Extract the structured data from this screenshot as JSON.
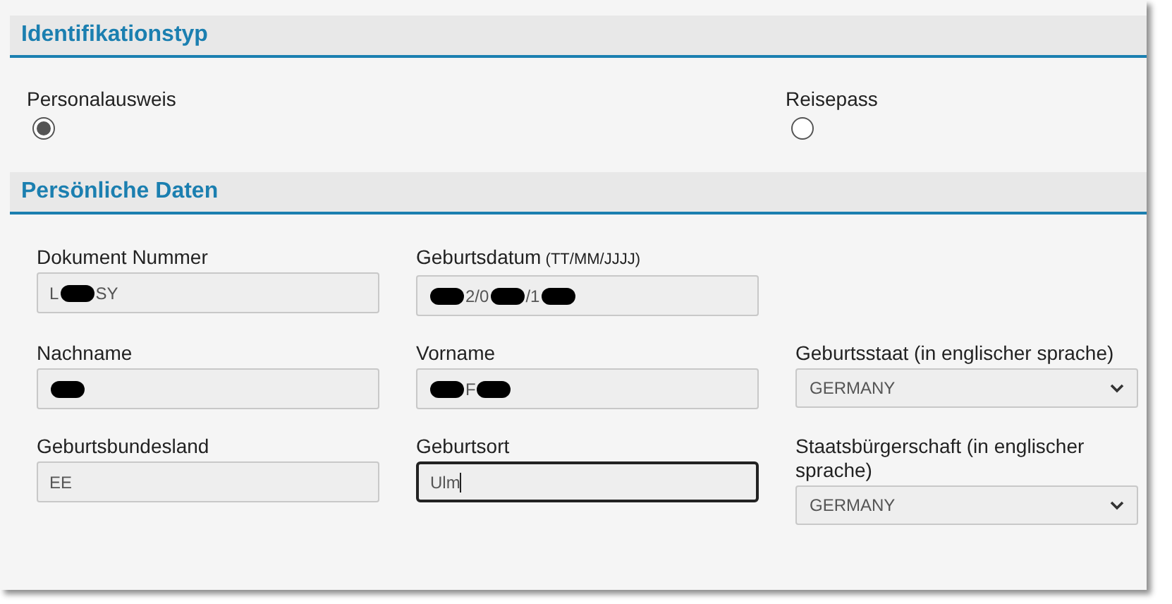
{
  "sections": [
    {
      "title": "Identifikationstyp",
      "kind": "radios",
      "options": [
        {
          "label": "Personalausweis",
          "selected": true
        },
        {
          "label": "Reisepass",
          "selected": false
        }
      ]
    },
    {
      "title": "Persönliche Daten",
      "kind": "fields",
      "rows": [
        [
          {
            "kind": "input",
            "label": "Dokument Nummer",
            "segments": [
              {
                "kind": "text",
                "text": "L"
              },
              {
                "kind": "redaction"
              },
              {
                "kind": "text",
                "text": "SY"
              }
            ],
            "focused": false
          },
          {
            "kind": "input",
            "label": "Geburtsdatum",
            "hint": "(TT/MM/JJJJ)",
            "segments": [
              {
                "kind": "redaction"
              },
              {
                "kind": "text",
                "text": "2/0"
              },
              {
                "kind": "redaction"
              },
              {
                "kind": "text",
                "text": "/1"
              },
              {
                "kind": "redaction"
              }
            ],
            "focused": false
          }
        ],
        [
          {
            "kind": "input",
            "label": "Nachname",
            "segments": [
              {
                "kind": "redaction"
              }
            ],
            "focused": false
          },
          {
            "kind": "input",
            "label": "Vorname",
            "segments": [
              {
                "kind": "redaction"
              },
              {
                "kind": "text",
                "text": "F"
              },
              {
                "kind": "redaction"
              }
            ],
            "focused": false
          },
          {
            "kind": "select",
            "label": "Geburtsstaat (in englischer sprache)",
            "value": "GERMANY"
          }
        ],
        [
          {
            "kind": "input",
            "label": "Geburtsbundesland",
            "segments": [
              {
                "kind": "text",
                "text": "EE"
              }
            ],
            "focused": false
          },
          {
            "kind": "input",
            "label": "Geburtsort",
            "segments": [
              {
                "kind": "text",
                "text": "Ulm"
              }
            ],
            "focused": true
          },
          {
            "kind": "select",
            "label": "Staatsbürgerschaft (in englischer sprache)",
            "value": "GERMANY"
          }
        ]
      ]
    }
  ]
}
